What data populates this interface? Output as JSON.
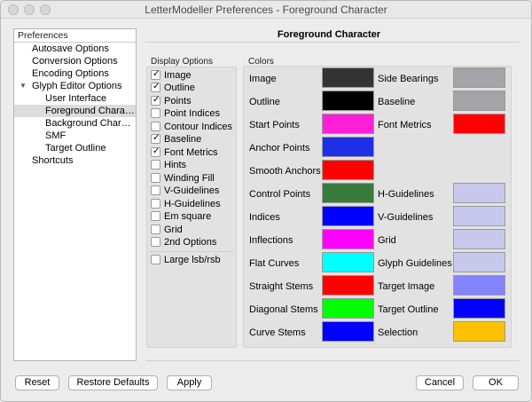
{
  "window": {
    "title": "LetterModeller Preferences - Foreground Character"
  },
  "sidebar": {
    "header": "Preferences",
    "items": [
      {
        "label": "Autosave Options",
        "level": 0
      },
      {
        "label": "Conversion Options",
        "level": 0
      },
      {
        "label": "Encoding Options",
        "level": 0
      },
      {
        "label": "Glyph Editor Options",
        "level": 0,
        "expanded": true
      },
      {
        "label": "User Interface",
        "level": 1
      },
      {
        "label": "Foreground Chara…",
        "level": 1,
        "selected": true
      },
      {
        "label": "Background Char…",
        "level": 1
      },
      {
        "label": "SMF",
        "level": 1
      },
      {
        "label": "Target Outline",
        "level": 1
      },
      {
        "label": "Shortcuts",
        "level": 0
      }
    ]
  },
  "panel": {
    "title": "Foreground Character"
  },
  "display_options": {
    "label": "Display Options",
    "items": [
      {
        "label": "Image",
        "checked": true
      },
      {
        "label": "Outline",
        "checked": true
      },
      {
        "label": "Points",
        "checked": true
      },
      {
        "label": "Point Indices",
        "checked": false
      },
      {
        "label": "Contour Indices",
        "checked": false
      },
      {
        "label": "Baseline",
        "checked": true
      },
      {
        "label": "Font Metrics",
        "checked": true
      },
      {
        "label": "Hints",
        "checked": false
      },
      {
        "label": "Winding Fill",
        "checked": false
      },
      {
        "label": "V-Guidelines",
        "checked": false
      },
      {
        "label": "H-Guidelines",
        "checked": false
      },
      {
        "label": "Em square",
        "checked": false
      },
      {
        "label": "Grid",
        "checked": false
      },
      {
        "label": "2nd Options",
        "checked": false
      }
    ],
    "extra": {
      "label": "Large lsb/rsb",
      "checked": false
    }
  },
  "colors": {
    "label": "Colors",
    "left": [
      {
        "label": "Image",
        "color": "#333333"
      },
      {
        "label": "Outline",
        "color": "#000000"
      },
      {
        "label": "Start Points",
        "color": "#ff1fd6"
      },
      {
        "label": "Anchor Points",
        "color": "#1f2fe6"
      },
      {
        "label": "Smooth Anchors",
        "color": "#ff0000"
      },
      {
        "label": "Control Points",
        "color": "#387a3c"
      },
      {
        "label": "Indices",
        "color": "#0000ff"
      },
      {
        "label": "Inflections",
        "color": "#ff00ff"
      },
      {
        "label": "Flat Curves",
        "color": "#00ffff"
      },
      {
        "label": "Straight Stems",
        "color": "#ff0000"
      },
      {
        "label": "Diagonal Stems",
        "color": "#00ff00"
      },
      {
        "label": "Curve Stems",
        "color": "#0000ff"
      }
    ],
    "right": [
      {
        "label": "Side Bearings",
        "color": "#a3a3a8"
      },
      {
        "label": "Baseline",
        "color": "#a3a3a8"
      },
      {
        "label": "Font Metrics",
        "color": "#ff0000"
      },
      {
        "label": "",
        "color": ""
      },
      {
        "label": "",
        "color": ""
      },
      {
        "label": "H-Guidelines",
        "color": "#c8c8ec"
      },
      {
        "label": "V-Guidelines",
        "color": "#c8c8ec"
      },
      {
        "label": "Grid",
        "color": "#c8c8ec"
      },
      {
        "label": "Glyph Guidelines",
        "color": "#c8c8ec"
      },
      {
        "label": "Target Image",
        "color": "#8484ff"
      },
      {
        "label": "Target Outline",
        "color": "#0000ff"
      },
      {
        "label": "Selection",
        "color": "#ffc200"
      }
    ]
  },
  "buttons": {
    "reset": "Reset",
    "restore": "Restore Defaults",
    "apply": "Apply",
    "cancel": "Cancel",
    "ok": "OK"
  },
  "check_glyph": "✓"
}
